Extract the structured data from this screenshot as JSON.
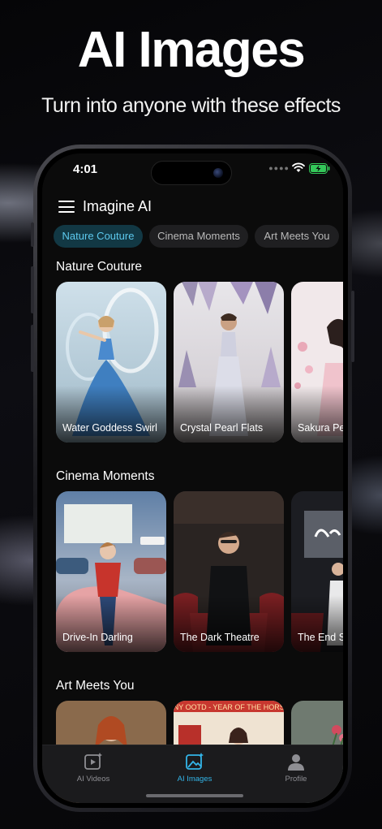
{
  "promo": {
    "title": "AI Images",
    "subtitle": "Turn into anyone with these effects"
  },
  "status_bar": {
    "time": "4:01",
    "battery_color": "#34c759"
  },
  "header": {
    "title": "Imagine AI"
  },
  "chips": [
    {
      "label": "Nature Couture",
      "active": true
    },
    {
      "label": "Cinema Moments",
      "active": false
    },
    {
      "label": "Art Meets You",
      "active": false
    }
  ],
  "sections": [
    {
      "title": "Nature Couture",
      "cards": [
        {
          "label": "Water Goddess Swirl"
        },
        {
          "label": "Crystal Pearl Flats"
        },
        {
          "label": "Sakura Peta"
        }
      ]
    },
    {
      "title": "Cinema Moments",
      "cards": [
        {
          "label": "Drive-In Darling"
        },
        {
          "label": "The Dark Theatre"
        },
        {
          "label": "The End Sc"
        }
      ]
    },
    {
      "title": "Art Meets You",
      "cards": [
        {
          "label": ""
        },
        {
          "label": "CNY OOTD - YEAR OF THE HORSE"
        },
        {
          "label": ""
        }
      ]
    }
  ],
  "tabs": [
    {
      "label": "AI Videos",
      "icon": "video-sparkle-icon",
      "active": false
    },
    {
      "label": "AI Images",
      "icon": "image-sparkle-icon",
      "active": true
    },
    {
      "label": "Profile",
      "icon": "person-icon",
      "active": false
    }
  ],
  "accent_color": "#33b5e8"
}
